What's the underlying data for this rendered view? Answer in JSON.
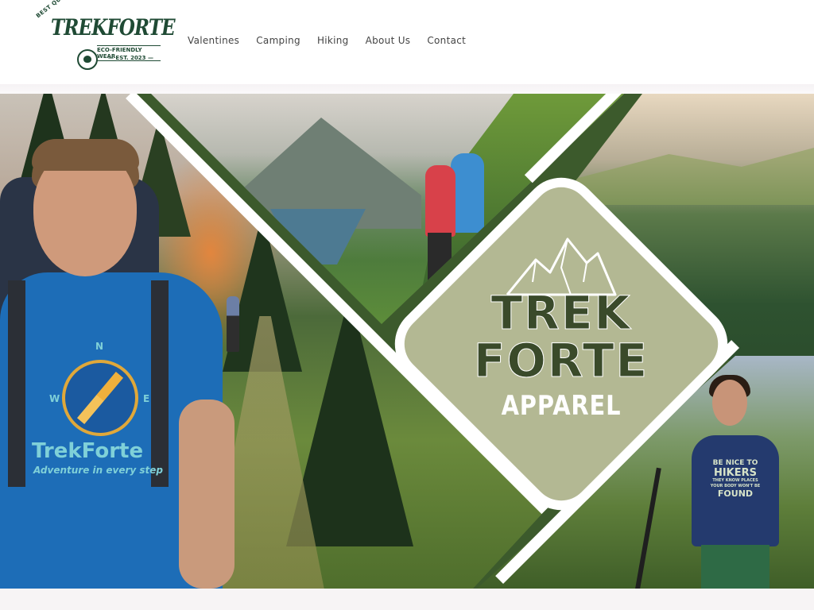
{
  "header": {
    "logo": {
      "badge_text": "BEST QUALITY",
      "brand": "TREKFORTE",
      "tagline": "ECO-FRIENDLY WEAR",
      "established": "— EST. 2023 —"
    },
    "nav": [
      "Valentines",
      "Camping",
      "Hiking",
      "About Us",
      "Contact"
    ]
  },
  "hero": {
    "diamond": {
      "line1": "TREK",
      "line2": "FORTE",
      "line3": "APPAREL"
    },
    "man_shirt": {
      "brand": "TrekForte",
      "tagline": "Adventure in every step",
      "compass_n": "N",
      "compass_w": "W",
      "compass_e": "E"
    },
    "woman_shirt": {
      "line1": "BE NICE TO",
      "line2": "HIKERS",
      "line3": "THEY KNOW PLACES",
      "line4": "YOUR BODY WON'T BE",
      "line5": "FOUND"
    }
  },
  "colors": {
    "brand_green": "#1f4a34",
    "diamond_bg": "#b3b893",
    "diamond_text": "#3a4a2a",
    "shirt_blue": "#1d6db7"
  }
}
